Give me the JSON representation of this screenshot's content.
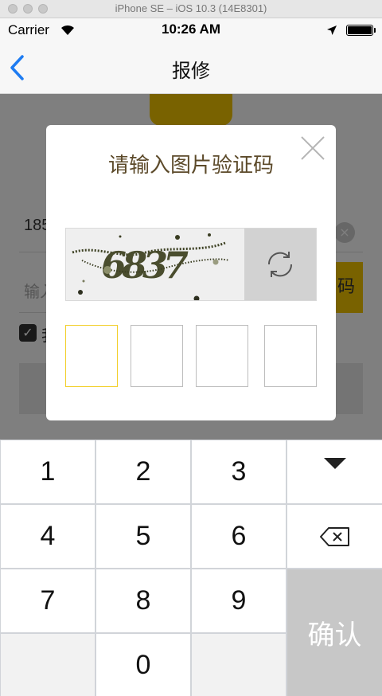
{
  "simulator": {
    "title": "iPhone SE – iOS 10.3 (14E8301)"
  },
  "status_bar": {
    "carrier": "Carrier",
    "time": "10:26 AM"
  },
  "nav": {
    "title": "报修"
  },
  "background_form": {
    "phone_value": "185",
    "code_placeholder": "输入",
    "get_code_label": "码",
    "agree_label": "我"
  },
  "modal": {
    "title": "请输入图片验证码",
    "captcha_text": "6837",
    "code_boxes": [
      "",
      "",
      "",
      ""
    ]
  },
  "keypad": {
    "keys": [
      "1",
      "2",
      "3",
      "4",
      "5",
      "6",
      "7",
      "8",
      "9",
      "0"
    ],
    "confirm_label": "确认"
  },
  "colors": {
    "accent_yellow": "#f2c500",
    "ios_blue": "#1e7cf2",
    "title_brown": "#5c4a2a",
    "overlay": "rgba(0,0,0,0.5)"
  }
}
